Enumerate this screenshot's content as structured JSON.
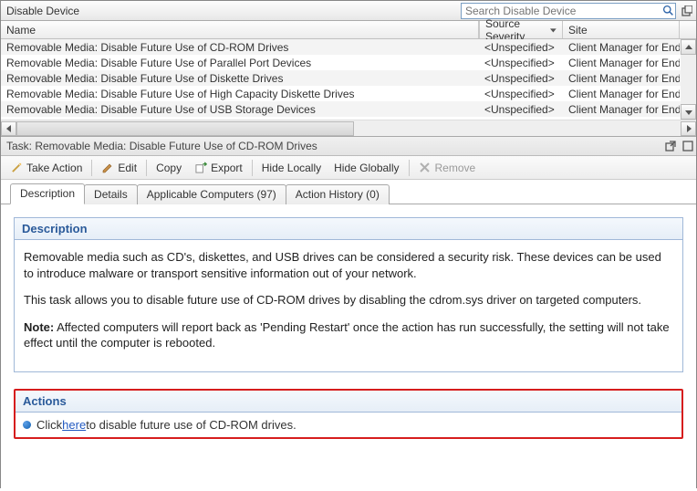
{
  "header": {
    "title": "Disable Device",
    "search_placeholder": "Search Disable Device"
  },
  "grid": {
    "columns": {
      "name": "Name",
      "severity": "Source Severity",
      "site": "Site"
    },
    "rows": [
      {
        "name": "Removable Media: Disable Future Use of CD-ROM Drives",
        "severity": "<Unspecified>",
        "site": "Client Manager for Endpoint"
      },
      {
        "name": "Removable Media: Disable Future Use of Parallel Port Devices",
        "severity": "<Unspecified>",
        "site": "Client Manager for Endpoint"
      },
      {
        "name": "Removable Media: Disable Future Use of Diskette Drives",
        "severity": "<Unspecified>",
        "site": "Client Manager for Endpoint"
      },
      {
        "name": "Removable Media: Disable Future Use of High Capacity Diskette Drives",
        "severity": "<Unspecified>",
        "site": "Client Manager for Endpoint"
      },
      {
        "name": "Removable Media: Disable Future Use of USB Storage Devices",
        "severity": "<Unspecified>",
        "site": "Client Manager for Endpoint"
      }
    ]
  },
  "task_title": "Task: Removable Media: Disable Future Use of CD-ROM Drives",
  "toolbar": {
    "take_action": "Take Action",
    "edit": "Edit",
    "copy": "Copy",
    "export": "Export",
    "hide_locally": "Hide Locally",
    "hide_globally": "Hide Globally",
    "remove": "Remove"
  },
  "tabs": {
    "description": "Description",
    "details": "Details",
    "applicable": "Applicable Computers (97)",
    "history": "Action History (0)"
  },
  "panels": {
    "description_head": "Description",
    "actions_head": "Actions",
    "para1": "Removable media such as CD's, diskettes, and USB drives can be considered a security risk. These devices can be used to introduce malware or transport sensitive information out of your network.",
    "para2": "This task allows you to disable future use of CD-ROM drives by disabling the cdrom.sys driver on targeted computers.",
    "note_label": "Note:",
    "note_text": " Affected computers will report back as 'Pending Restart' once the action has run successfully, the setting will not take effect until the computer is rebooted.",
    "action_pre": "Click ",
    "action_link": "here",
    "action_post": " to disable future use of CD-ROM drives."
  }
}
